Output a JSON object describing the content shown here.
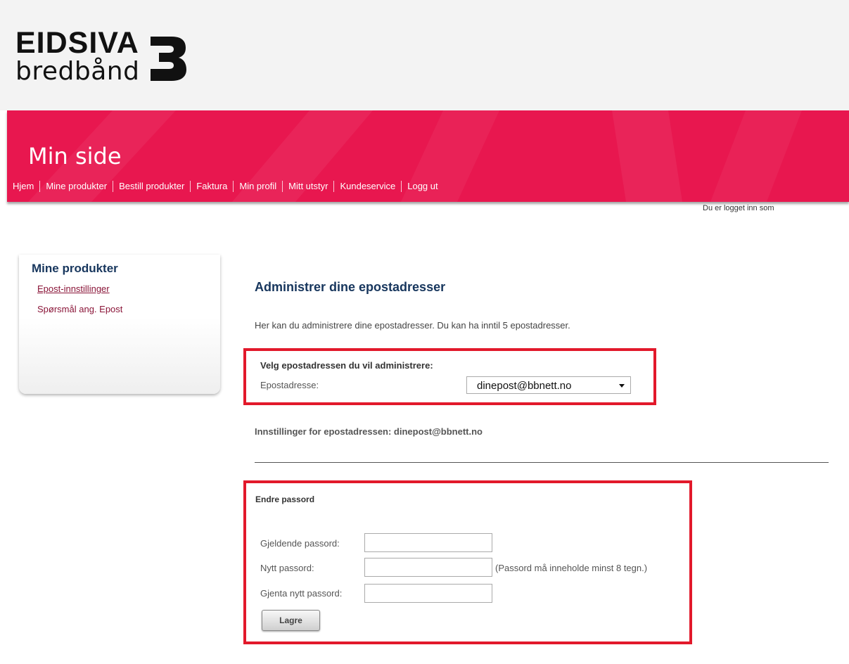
{
  "header": {
    "logo_brand": "EIDSIVA",
    "logo_sub": "bredbånd"
  },
  "banner": {
    "title": "Min side",
    "nav": [
      "Hjem",
      "Mine produkter",
      "Bestill produkter",
      "Faktura",
      "Min profil",
      "Mitt utstyr",
      "Kundeservice",
      "Logg ut"
    ]
  },
  "user": {
    "logged_in_text": "Du er logget inn som"
  },
  "sidebar": {
    "title": "Mine produkter",
    "links": [
      "Epost-innstillinger",
      "Spørsmål ang. Epost"
    ]
  },
  "main": {
    "heading": "Administrer dine epostadresser",
    "intro": "Her kan du administrere dine epostadresser. Du kan ha inntil 5 epostadresser.",
    "select_section": {
      "title": "Velg epostadressen du vil administrere:",
      "label": "Epostadresse:",
      "selected": "dinepost@bbnett.no"
    },
    "settings_heading": "Innstillinger for epostadressen: dinepost@bbnett.no",
    "password_section": {
      "title": "Endre passord",
      "current_label": "Gjeldende passord:",
      "new_label": "Nytt passord:",
      "repeat_label": "Gjenta nytt passord:",
      "hint": "(Passord må inneholde minst 8 tegn.)",
      "save_label": "Lagre"
    }
  },
  "colors": {
    "brand_pink": "#e8174f",
    "highlight_red": "#e2192b",
    "heading_navy": "#17365d",
    "link_maroon": "#8a1538"
  }
}
